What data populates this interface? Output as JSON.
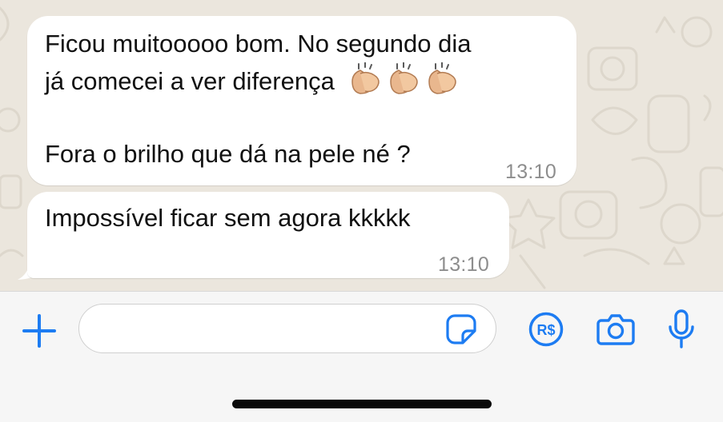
{
  "conversation": {
    "messages": [
      {
        "lines": [
          "Ficou muitooooo bom. No segundo dia",
          "já comecei a ver diferença",
          "",
          "Fora o brilho que dá na pele né ?"
        ],
        "emoji": "clapping-hands-emoji",
        "time": "13:10"
      },
      {
        "lines": [
          "Impossível ficar sem agora kkkkk"
        ],
        "time": "13:10"
      }
    ]
  },
  "composer": {
    "input_value": "",
    "input_placeholder": "",
    "icons": {
      "add": "plus-icon",
      "sticker": "sticker-icon",
      "payment": "payment-icon",
      "camera": "camera-icon",
      "microphone": "microphone-icon"
    },
    "payment_label": "R$"
  },
  "colors": {
    "accent": "#1d7cf2",
    "chat_background": "#ebe6dd",
    "bubble": "#ffffff",
    "timestamp": "#8d8d8d",
    "bar_background": "#f6f6f6"
  }
}
